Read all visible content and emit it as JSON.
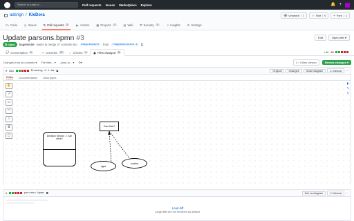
{
  "topbar": {
    "search_placeholder": "Search or jump to...",
    "nav": [
      "Pull requests",
      "Issues",
      "Marketplace",
      "Explore"
    ]
  },
  "repo": {
    "owner": "aderign",
    "name": "KleDora",
    "buttons": [
      {
        "label": "Unwatch",
        "count": "1"
      },
      {
        "label": "Star",
        "count": "0"
      },
      {
        "label": "Fork",
        "count": "1"
      }
    ],
    "tabs": [
      {
        "label": "Code",
        "badge": ""
      },
      {
        "label": "Issues",
        "badge": ""
      },
      {
        "label": "Pull requests",
        "badge": "2"
      },
      {
        "label": "Actions",
        "badge": ""
      },
      {
        "label": "Projects",
        "badge": "0"
      },
      {
        "label": "Wiki",
        "badge": ""
      },
      {
        "label": "Security",
        "badge": "0"
      },
      {
        "label": "Insights",
        "badge": ""
      },
      {
        "label": "Settings",
        "badge": ""
      }
    ]
  },
  "pr": {
    "title": "Update parsons.bpmn",
    "number": "#3",
    "edit_label": "Edit",
    "open_with_label": "Open with",
    "state": "Open",
    "author": "bagelsmite",
    "meta_text": "wants to merge 37 commits into",
    "base_branch": "diagramsaver",
    "from_text": "from",
    "head_branch": "flagdemo/patch-1",
    "tabs": [
      {
        "label": "Conversation",
        "badge": "0"
      },
      {
        "label": "Commits",
        "badge": "37"
      },
      {
        "label": "Checks",
        "badge": "0"
      },
      {
        "label": "Files changed",
        "badge": "5"
      }
    ],
    "additions": "+49",
    "deletions": "-92"
  },
  "toolbar": {
    "changes_from": "Changes from all commits",
    "file_filter": "File filter...",
    "jump_to": "Jump to...",
    "files_viewed": "0 / 5 files viewed",
    "review_changes": "Review changes"
  },
  "file1": {
    "changes": "363",
    "name": "Drawing 1-1.bm",
    "views": [
      "Original",
      "Changes",
      "Close diagram"
    ],
    "viewed_label": "Viewed",
    "editor_tabs": [
      "Editor",
      "Documentation",
      "Data types"
    ],
    "palette_icons": [
      "hand-tool-icon",
      "connect-tool-icon",
      "task-icon",
      "rect-icon",
      "event-icon",
      "database-icon",
      "comment-icon"
    ]
  },
  "diagram": {
    "subprocess_label": "Decision Service -> Can drive?",
    "decision_label": "Can drive?",
    "input1_label": "ages",
    "input2_label": "country"
  },
  "file2": {
    "changes": "",
    "name": "parsons.bpmn",
    "view_label": "See as diagram",
    "viewed_label": "Viewed",
    "load_diff": "Load diff",
    "load_sub": "Large diffs are not rendered by default."
  },
  "colors": {
    "open": "#28a745",
    "add": "#28a745",
    "del": "#cb2431",
    "link": "#0366d6",
    "tab_accent": "#f9826c"
  }
}
